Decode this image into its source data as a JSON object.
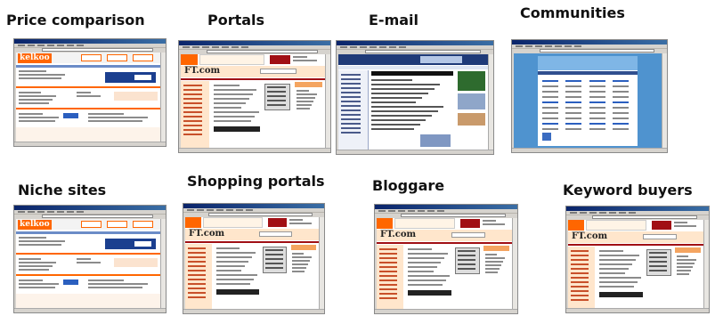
{
  "items": [
    {
      "label": "Price comparison",
      "type": "kelkoo",
      "logo_text": "kelkoo"
    },
    {
      "label": "Portals",
      "type": "ft",
      "logo_text": "FT.com"
    },
    {
      "label": "E-mail",
      "type": "email",
      "logo_text": ""
    },
    {
      "label": "Communities",
      "type": "community",
      "logo_text": ""
    },
    {
      "label": "Niche sites",
      "type": "kelkoo",
      "logo_text": "kelkoo"
    },
    {
      "label": "Shopping portals",
      "type": "ft",
      "logo_text": "FT.com"
    },
    {
      "label": "Bloggare",
      "type": "ft",
      "logo_text": "FT.com"
    },
    {
      "label": "Keyword buyers",
      "type": "ft",
      "logo_text": "FT.com"
    }
  ],
  "colors": {
    "kelkoo": "#ff6600",
    "ft_salmon": "#ffe6cc",
    "ft_red": "#a10f14",
    "email_navy": "#1f3a78",
    "community_blue": "#4f93cf"
  }
}
